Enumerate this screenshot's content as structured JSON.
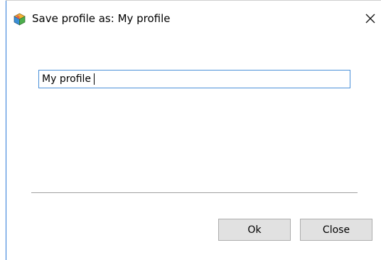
{
  "window": {
    "title": "Save profile as: My profile",
    "icon": "app-cube-icon",
    "close_icon": "close-icon"
  },
  "form": {
    "profile_name_value": "My profile"
  },
  "buttons": {
    "ok_label": "Ok",
    "close_label": "Close"
  },
  "colors": {
    "input_border": "#4a90d9",
    "window_accent": "#2b79d8",
    "button_face": "#e1e1e1",
    "button_border": "#adadad"
  }
}
